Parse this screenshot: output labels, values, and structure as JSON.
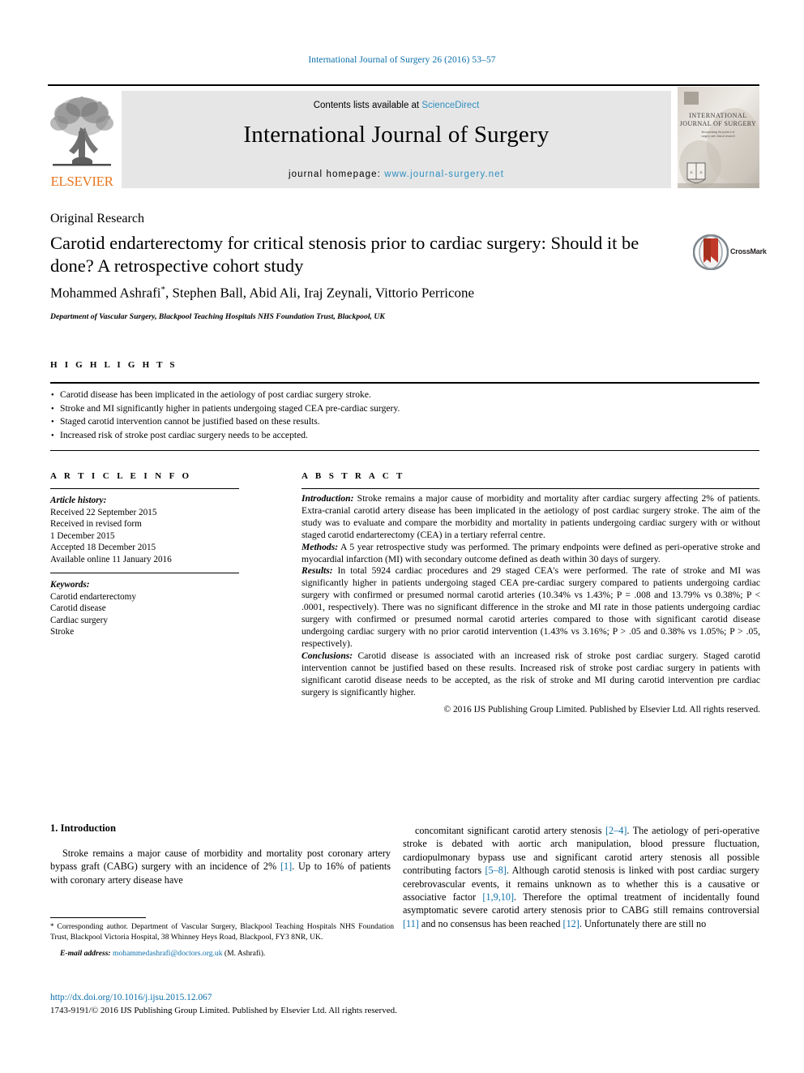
{
  "running_head": "International Journal of Surgery 26 (2016) 53–57",
  "masthead": {
    "publisher_logo_text": "ELSEVIER",
    "contents_prefix": "Contents lists available at ",
    "contents_link": "ScienceDirect",
    "journal_title": "International Journal of Surgery",
    "homepage_prefix": "journal homepage: ",
    "homepage_url": "www.journal-surgery.net",
    "cover_title_line1": "INTERNATIONAL",
    "cover_title_line2": "JOURNAL OF SURGERY"
  },
  "article": {
    "type": "Original Research",
    "title": "Carotid endarterectomy for critical stenosis prior to cardiac surgery: Should it be done? A retrospective cohort study",
    "authors": "Mohammed Ashrafi",
    "authors_rest": ", Stephen Ball, Abid Ali, Iraj Zeynali, Vittorio Perricone",
    "corresponding_marker": "*",
    "affiliation": "Department of Vascular Surgery, Blackpool Teaching Hospitals NHS Foundation Trust, Blackpool, UK",
    "crossmark_label": "CrossMark"
  },
  "highlights": {
    "heading": "H I G H L I G H T S",
    "items": [
      "Carotid disease has been implicated in the aetiology of post cardiac surgery stroke.",
      "Stroke and MI significantly higher in patients undergoing staged CEA pre-cardiac surgery.",
      "Staged carotid intervention cannot be justified based on these results.",
      "Increased risk of stroke post cardiac surgery needs to be accepted."
    ]
  },
  "article_info": {
    "heading": "A R T I C L E  I N F O",
    "history_label": "Article history:",
    "history_lines": [
      "Received 22 September 2015",
      "Received in revised form",
      "1 December 2015",
      "Accepted 18 December 2015",
      "Available online 11 January 2016"
    ],
    "keywords_label": "Keywords:",
    "keywords": [
      "Carotid endarterectomy",
      "Carotid disease",
      "Cardiac surgery",
      "Stroke"
    ]
  },
  "abstract": {
    "heading": "A B S T R A C T",
    "sections": [
      {
        "label": "Introduction:",
        "text": "Stroke remains a major cause of morbidity and mortality after cardiac surgery affecting 2% of patients. Extra-cranial carotid artery disease has been implicated in the aetiology of post cardiac surgery stroke. The aim of the study was to evaluate and compare the morbidity and mortality in patients undergoing cardiac surgery with or without staged carotid endarterectomy (CEA) in a tertiary referral centre."
      },
      {
        "label": "Methods:",
        "text": "A 5 year retrospective study was performed. The primary endpoints were defined as peri-operative stroke and myocardial infarction (MI) with secondary outcome defined as death within 30 days of surgery."
      },
      {
        "label": "Results:",
        "text": "In total 5924 cardiac procedures and 29 staged CEA's were performed. The rate of stroke and MI was significantly higher in patients undergoing staged CEA pre-cardiac surgery compared to patients undergoing cardiac surgery with confirmed or presumed normal carotid arteries (10.34% vs 1.43%; P = .008 and 13.79% vs 0.38%; P < .0001, respectively). There was no significant difference in the stroke and MI rate in those patients undergoing cardiac surgery with confirmed or presumed normal carotid arteries compared to those with significant carotid disease undergoing cardiac surgery with no prior carotid intervention (1.43% vs 3.16%; P > .05 and 0.38% vs 1.05%; P > .05, respectively)."
      },
      {
        "label": "Conclusions:",
        "text": "Carotid disease is associated with an increased risk of stroke post cardiac surgery. Staged carotid intervention cannot be justified based on these results. Increased risk of stroke post cardiac surgery in patients with significant carotid disease needs to be accepted, as the risk of stroke and MI during carotid intervention pre cardiac surgery is significantly higher."
      }
    ],
    "copyright": "© 2016 IJS Publishing Group Limited. Published by Elsevier Ltd. All rights reserved."
  },
  "body": {
    "section_heading": "1. Introduction",
    "left_paragraph_a": "Stroke remains a major cause of morbidity and mortality post coronary artery bypass graft (CABG) surgery with an incidence of 2% ",
    "left_ref_1": "[1]",
    "left_paragraph_b": ". Up to 16% of patients with coronary artery disease have",
    "right_parts": [
      {
        "text": "concomitant significant carotid artery stenosis ",
        "ref": false
      },
      {
        "text": "[2–4]",
        "ref": true
      },
      {
        "text": ". The aetiology of peri-operative stroke is debated with aortic arch manipulation, blood pressure fluctuation, cardiopulmonary bypass use and significant carotid artery stenosis all possible contributing factors ",
        "ref": false
      },
      {
        "text": "[5–8]",
        "ref": true
      },
      {
        "text": ". Although carotid stenosis is linked with post cardiac surgery cerebrovascular events, it remains unknown as to whether this is a causative or associative factor ",
        "ref": false
      },
      {
        "text": "[1,9,10]",
        "ref": true
      },
      {
        "text": ". Therefore the optimal treatment of incidentally found asymptomatic severe carotid artery stenosis prior to CABG still remains controversial ",
        "ref": false
      },
      {
        "text": "[11]",
        "ref": true
      },
      {
        "text": " and no consensus has been reached ",
        "ref": false
      },
      {
        "text": "[12]",
        "ref": true
      },
      {
        "text": ". Unfortunately there are still no",
        "ref": false
      }
    ]
  },
  "footer": {
    "corresponding_text": "Corresponding author. Department of Vascular Surgery, Blackpool Teaching Hospitals NHS Foundation Trust, Blackpool Victoria Hospital, 38 Whinney Heys Road, Blackpool, FY3 8NR, UK.",
    "email_label": "E-mail address:",
    "email": "mohammedashrafi@doctors.org.uk",
    "email_suffix": " (M. Ashrafi).",
    "doi": "http://dx.doi.org/10.1016/j.ijsu.2015.12.067",
    "issn_line": "1743-9191/© 2016 IJS Publishing Group Limited. Published by Elsevier Ltd. All rights reserved."
  },
  "colors": {
    "link": "#0b6ea8",
    "elsevier_orange": "#E87722",
    "band_gray": "#e6e6e6"
  }
}
